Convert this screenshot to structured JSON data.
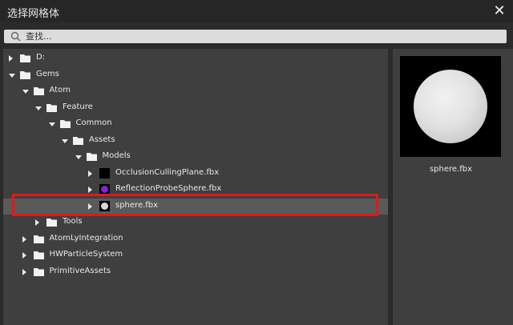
{
  "dialog": {
    "title": "选择网格体"
  },
  "search": {
    "placeholder": "查找..."
  },
  "tree": [
    {
      "label": "D:",
      "kind": "folder",
      "level": 0,
      "arrow": "right"
    },
    {
      "label": "Gems",
      "kind": "folder",
      "level": 0,
      "arrow": "down"
    },
    {
      "label": "Atom",
      "kind": "folder",
      "level": 1,
      "arrow": "down"
    },
    {
      "label": "Feature",
      "kind": "folder",
      "level": 2,
      "arrow": "down"
    },
    {
      "label": "Common",
      "kind": "folder",
      "level": 3,
      "arrow": "down"
    },
    {
      "label": "Assets",
      "kind": "folder",
      "level": 4,
      "arrow": "down"
    },
    {
      "label": "Models",
      "kind": "folder",
      "level": 5,
      "arrow": "down"
    },
    {
      "label": "OcclusionCullingPlane.fbx",
      "kind": "file",
      "level": 6,
      "arrow": "right",
      "thumb_color": "#000000"
    },
    {
      "label": "ReflectionProbeSphere.fbx",
      "kind": "file",
      "level": 6,
      "arrow": "right",
      "thumb_color": "#8a1fd6"
    },
    {
      "label": "sphere.fbx",
      "kind": "file",
      "level": 6,
      "arrow": "right",
      "thumb_color": "#d8d8d8",
      "selected": true
    },
    {
      "label": "Tools",
      "kind": "folder",
      "level": 2,
      "arrow": "right"
    },
    {
      "label": "AtomLyIntegration",
      "kind": "folder",
      "level": 1,
      "arrow": "right"
    },
    {
      "label": "HWParticleSystem",
      "kind": "folder",
      "level": 1,
      "arrow": "right"
    },
    {
      "label": "PrimitiveAssets",
      "kind": "folder",
      "level": 1,
      "arrow": "right"
    }
  ],
  "preview": {
    "label": "sphere.fbx"
  },
  "colors": {
    "highlight_border": "#e01a1a",
    "selected_row": "#5a5a5a",
    "panel": "#3f3f3f"
  }
}
